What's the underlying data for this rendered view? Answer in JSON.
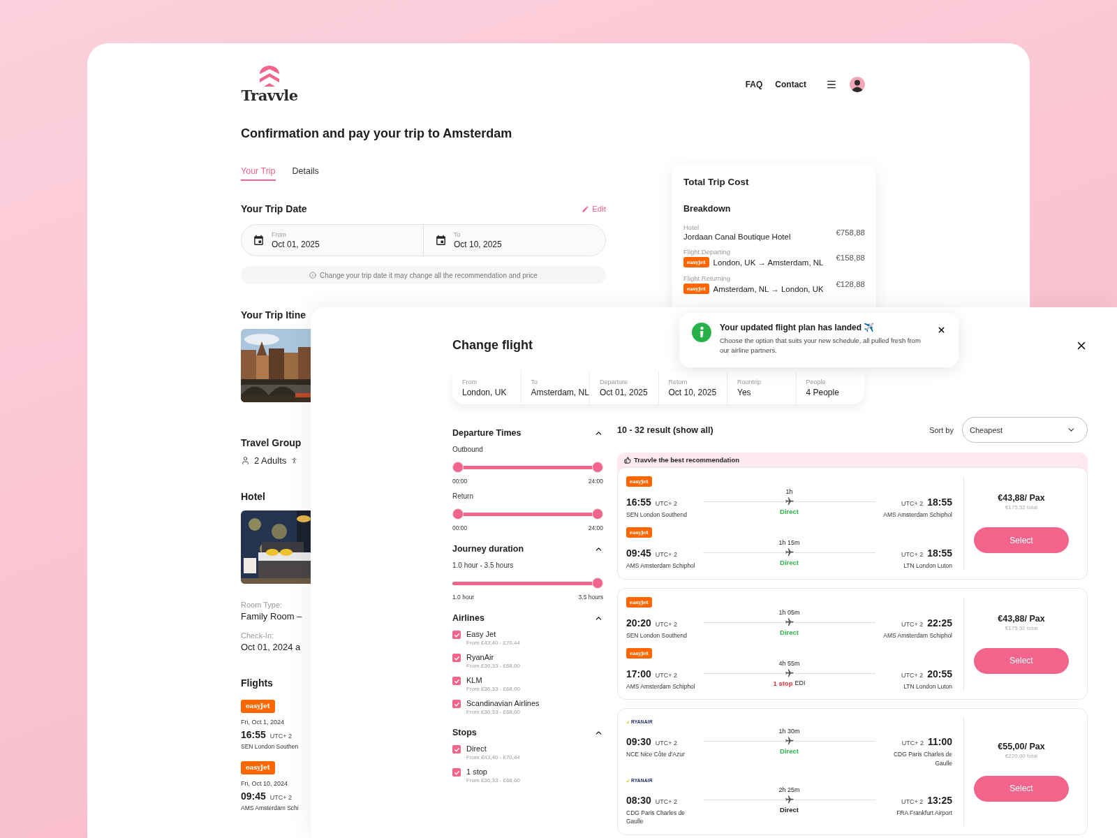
{
  "brand": {
    "name": "Travvle"
  },
  "nav": [
    {
      "label": "FAQ"
    },
    {
      "label": "Contact"
    }
  ],
  "page_title": "Confirmation and pay your trip to Amsterdam",
  "tabs": [
    {
      "label": "Your Trip",
      "selected": true
    },
    {
      "label": "Details",
      "selected": false
    }
  ],
  "trip_date": {
    "title": "Your Trip Date",
    "edit": "Edit",
    "fields": [
      {
        "label": "From",
        "value": "Oct 01, 2025"
      },
      {
        "label": "To",
        "value": "Oct 10, 2025"
      }
    ],
    "note": "Change your trip date it may change all the recommendation and price"
  },
  "itinerary": {
    "title": "Your Trip Itine"
  },
  "travel_group": {
    "title": "Travel Group",
    "adults": "2 Adults"
  },
  "hotel": {
    "title": "Hotel",
    "details": [
      {
        "label": "Room Type:",
        "value": "Family Room –"
      },
      {
        "label": "Check-In:",
        "value": "Oct 01, 2024 a"
      }
    ]
  },
  "flights": {
    "title": "Flights",
    "items": [
      {
        "airline": {
          "kind": "badge",
          "name": "easyJet"
        },
        "date": "Fri, Oct 1, 2024",
        "time": "16:55",
        "zone": "UTC+ 2",
        "airport": "SEN London Southen"
      },
      {
        "airline": {
          "kind": "badge",
          "name": "easyJet"
        },
        "date": "Fri, Oct 10, 2024",
        "time": "09:45",
        "zone": "UTC+ 2",
        "airport": "AMS Amsterdam Schi"
      }
    ]
  },
  "cost": {
    "title": "Total Trip Cost",
    "subtitle": "Breakdown",
    "items": [
      {
        "kind": "hotel",
        "label": "Hotel",
        "name": "Jordaan Canal Boutique Hotel",
        "price": "€758,88"
      },
      {
        "kind": "flight",
        "label": "Flight Departing",
        "airline": "easyJet",
        "name": "London, UK → Amsterdam, NL",
        "price": "€158,88"
      },
      {
        "kind": "flight",
        "label": "Flight Returning",
        "airline": "easyJet",
        "name": "Amsterdam, NL → London, UK",
        "price": "€128,88"
      }
    ]
  },
  "modal": {
    "title": "Change flight",
    "summary": [
      {
        "label": "From",
        "value": "London, UK"
      },
      {
        "label": "To",
        "value": "Amsterdam, NL"
      },
      {
        "label": "Departure",
        "value": "Oct 01, 2025"
      },
      {
        "label": "Return",
        "value": "Oct 10, 2025"
      },
      {
        "label": "Rountrip",
        "value": "Yes"
      },
      {
        "label": "People",
        "value": "4 People"
      }
    ],
    "toast": {
      "title": "Your updated flight plan has landed ✈️",
      "text": "Choose the option that suits your new schedule, all pulled fresh from our airline partners."
    },
    "filters": [
      {
        "kind": "sliders",
        "title": "Departure Times",
        "expanded": true,
        "sliders": [
          {
            "kind": "range",
            "label": "Outbound",
            "min_label": "00:00",
            "max_label": "24:00",
            "level": 1
          },
          {
            "kind": "range",
            "label": "Return",
            "min_label": "00:00",
            "max_label": "24:00",
            "level": 1
          }
        ]
      },
      {
        "kind": "sliders",
        "title": "Journey duration",
        "expanded": true,
        "sliders": [
          {
            "kind": "single",
            "label": "1.0 hour - 3.5 hours",
            "min_label": "1.0 hour",
            "max_label": "3.5 hours",
            "level": 1
          }
        ]
      },
      {
        "kind": "checks",
        "title": "Airlines",
        "expanded": true,
        "options": [
          {
            "label": "Easy Jet",
            "range": "From £43,40 - £70,44",
            "checked": true
          },
          {
            "label": "RyanAir",
            "range": "From £36,33 - £68,00",
            "checked": true
          },
          {
            "label": "KLM",
            "range": "From £36,33 - £68,00",
            "checked": true
          },
          {
            "label": "Scandinavian Airlines",
            "range": "From £36,33 - £68,00",
            "checked": true
          }
        ]
      },
      {
        "kind": "checks",
        "title": "Stops",
        "expanded": true,
        "options": [
          {
            "label": "Direct",
            "range": "From £43,40 - £70,44",
            "checked": true
          },
          {
            "label": "1 stop",
            "range": "From £36,33 - £68,00",
            "checked": true
          }
        ]
      }
    ],
    "results": {
      "count": "10 - 32 result (show all)",
      "sort_label": "Sort by",
      "sort_value": "Cheapest",
      "offers": [
        {
          "badge": "Travvle the best recommendation",
          "price": "€43,88/ Pax",
          "total": "€175,52 total",
          "button": "Select",
          "legs": [
            {
              "airline": {
                "kind": "badge",
                "name": "easyJet"
              },
              "dep_time": "16:55",
              "dep_zone": "UTC+ 2",
              "dep_airport": "SEN London Southend",
              "duration": "1h",
              "stops": {
                "text": "Direct",
                "color": "#2db84c"
              },
              "arr_zone": "UTC+ 2",
              "arr_time": "18:55",
              "arr_airport": "AMS Amsterdam Schiphol"
            },
            {
              "airline": {
                "kind": "badge",
                "name": "easyJet"
              },
              "dep_time": "09:45",
              "dep_zone": "UTC+ 2",
              "dep_airport": "AMS Amsterdam Schiphol",
              "duration": "1h 15m",
              "stops": {
                "text": "Direct",
                "color": "#2db84c"
              },
              "arr_zone": "UTC+ 2",
              "arr_time": "18:55",
              "arr_airport": "LTN London Luton"
            }
          ]
        },
        {
          "price": "€43,88/ Pax",
          "total": "€175,52 total",
          "button": "Select",
          "legs": [
            {
              "airline": {
                "kind": "badge",
                "name": "easyJet"
              },
              "dep_time": "20:20",
              "dep_zone": "UTC+ 2",
              "dep_airport": "SEN London Southend",
              "duration": "1h 05m",
              "stops": {
                "text": "Direct",
                "color": "#2db84c"
              },
              "arr_zone": "UTC+ 2",
              "arr_time": "22:25",
              "arr_airport": "AMS Amsterdam Schiphol"
            },
            {
              "airline": {
                "kind": "badge",
                "name": "easyJet"
              },
              "dep_time": "17:00",
              "dep_zone": "UTC+ 2",
              "dep_airport": "AMS Amsterdam Schiphol",
              "duration": "4h 55m",
              "stops": {
                "text": "1 stop",
                "color": "#e0353b"
              },
              "via": "EDI",
              "arr_zone": "UTC+ 2",
              "arr_time": "20:55",
              "arr_airport": "LTN London Luton"
            }
          ]
        },
        {
          "price": "€55,00/ Pax",
          "total": "€220,00 total",
          "button": "Select",
          "legs": [
            {
              "airline": {
                "kind": "wordmark",
                "name": "RYANAIR"
              },
              "dep_time": "09:30",
              "dep_zone": "UTC+ 2",
              "dep_airport": "NCE Nice Côte d'Azur",
              "duration": "1h 30m",
              "stops": {
                "text": "Direct",
                "color": "#2db84c"
              },
              "arr_zone": "UTC+ 2",
              "arr_time": "11:00",
              "arr_airport": "CDG Paris Charles de Gaulle"
            },
            {
              "airline": {
                "kind": "wordmark",
                "name": "RYANAIR"
              },
              "dep_time": "08:30",
              "dep_zone": "UTC+ 2",
              "dep_airport": "CDG Paris Charles de Gaulle",
              "duration": "2h 25m",
              "stops": {
                "text": "Direct",
                "color": "#222222"
              },
              "arr_zone": "UTC+ 2",
              "arr_time": "13:25",
              "arr_airport": "FRA Frankfurt Airport"
            }
          ]
        }
      ]
    }
  }
}
